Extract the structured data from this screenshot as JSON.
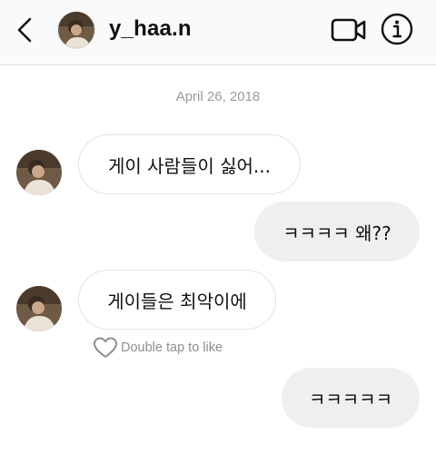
{
  "header": {
    "username": "y_haa.n",
    "back_icon": "chevron-left-icon",
    "video_icon": "video-camera-icon",
    "info_icon": "info-circle-icon"
  },
  "thread": {
    "date": "April 26, 2018",
    "messages": [
      {
        "sender": "them",
        "text": "게이 사람들이 싫어..."
      },
      {
        "sender": "me",
        "text": "ㅋㅋㅋㅋ 왜??"
      },
      {
        "sender": "them",
        "text": "게이들은 최악이에"
      },
      {
        "sender": "me",
        "text": "ㅋㅋㅋㅋㅋ"
      }
    ],
    "like_hint": "Double tap to like"
  },
  "colors": {
    "header_bg": "#fafafa",
    "incoming_bubble_border": "#e3e3e3",
    "outgoing_bubble_bg": "#efefef",
    "muted_text": "#8e8e8e"
  }
}
